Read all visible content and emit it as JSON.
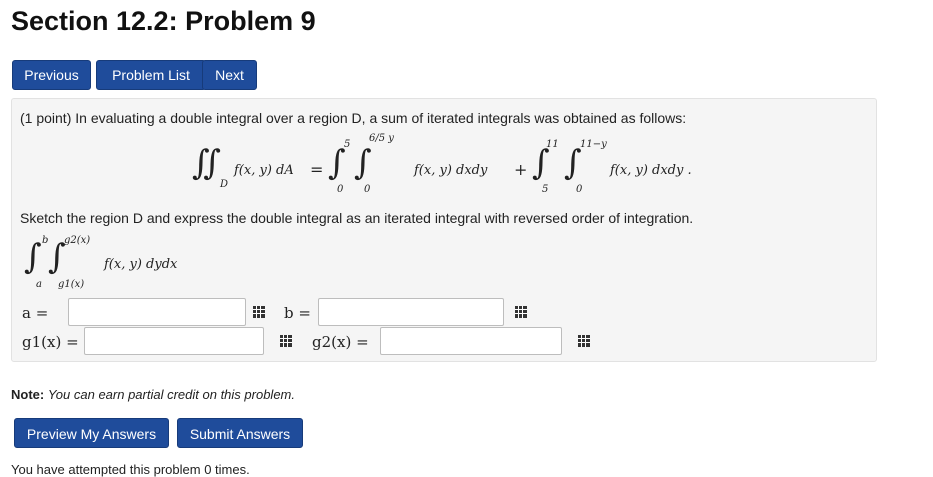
{
  "header": {
    "title": "Section 12.2: Problem 9"
  },
  "nav": {
    "previous_label": "Previous",
    "problem_list_label": "Problem List",
    "next_label": "Next"
  },
  "problem": {
    "intro": "(1 point) In evaluating a double integral over a region D, a sum of iterated integrals was obtained as follows:",
    "formula": {
      "lhs_integrand": "f(x, y) dA",
      "lhs_region": "D",
      "term1": {
        "outer_upper": "5",
        "outer_lower": "0",
        "inner_upper": "6/5 y",
        "inner_lower": "0",
        "integrand": "f(x, y) dxdy"
      },
      "term2": {
        "outer_upper": "11",
        "outer_lower": "5",
        "inner_upper": "11−y",
        "inner_lower": "0",
        "integrand": "f(x, y) dxdy ."
      }
    },
    "instruction": "Sketch the region D and express the double integral as an iterated integral with reversed order of integration.",
    "answer_template": {
      "outer_upper": "b",
      "outer_lower": "a",
      "inner_upper": "g2(x)",
      "inner_lower": "g1(x)",
      "integrand": "f(x, y) dydx"
    },
    "fields": {
      "a_label": "a =",
      "b_label": "b =",
      "g1_label": "g1(x) =",
      "g2_label": "g2(x) =",
      "a_value": "",
      "b_value": "",
      "g1_value": "",
      "g2_value": ""
    }
  },
  "note": {
    "label": "Note:",
    "text": "You can earn partial credit on this problem."
  },
  "actions": {
    "preview_label": "Preview My Answers",
    "submit_label": "Submit Answers"
  },
  "footer": {
    "cut_text": "You have attempted this problem 0 times."
  }
}
